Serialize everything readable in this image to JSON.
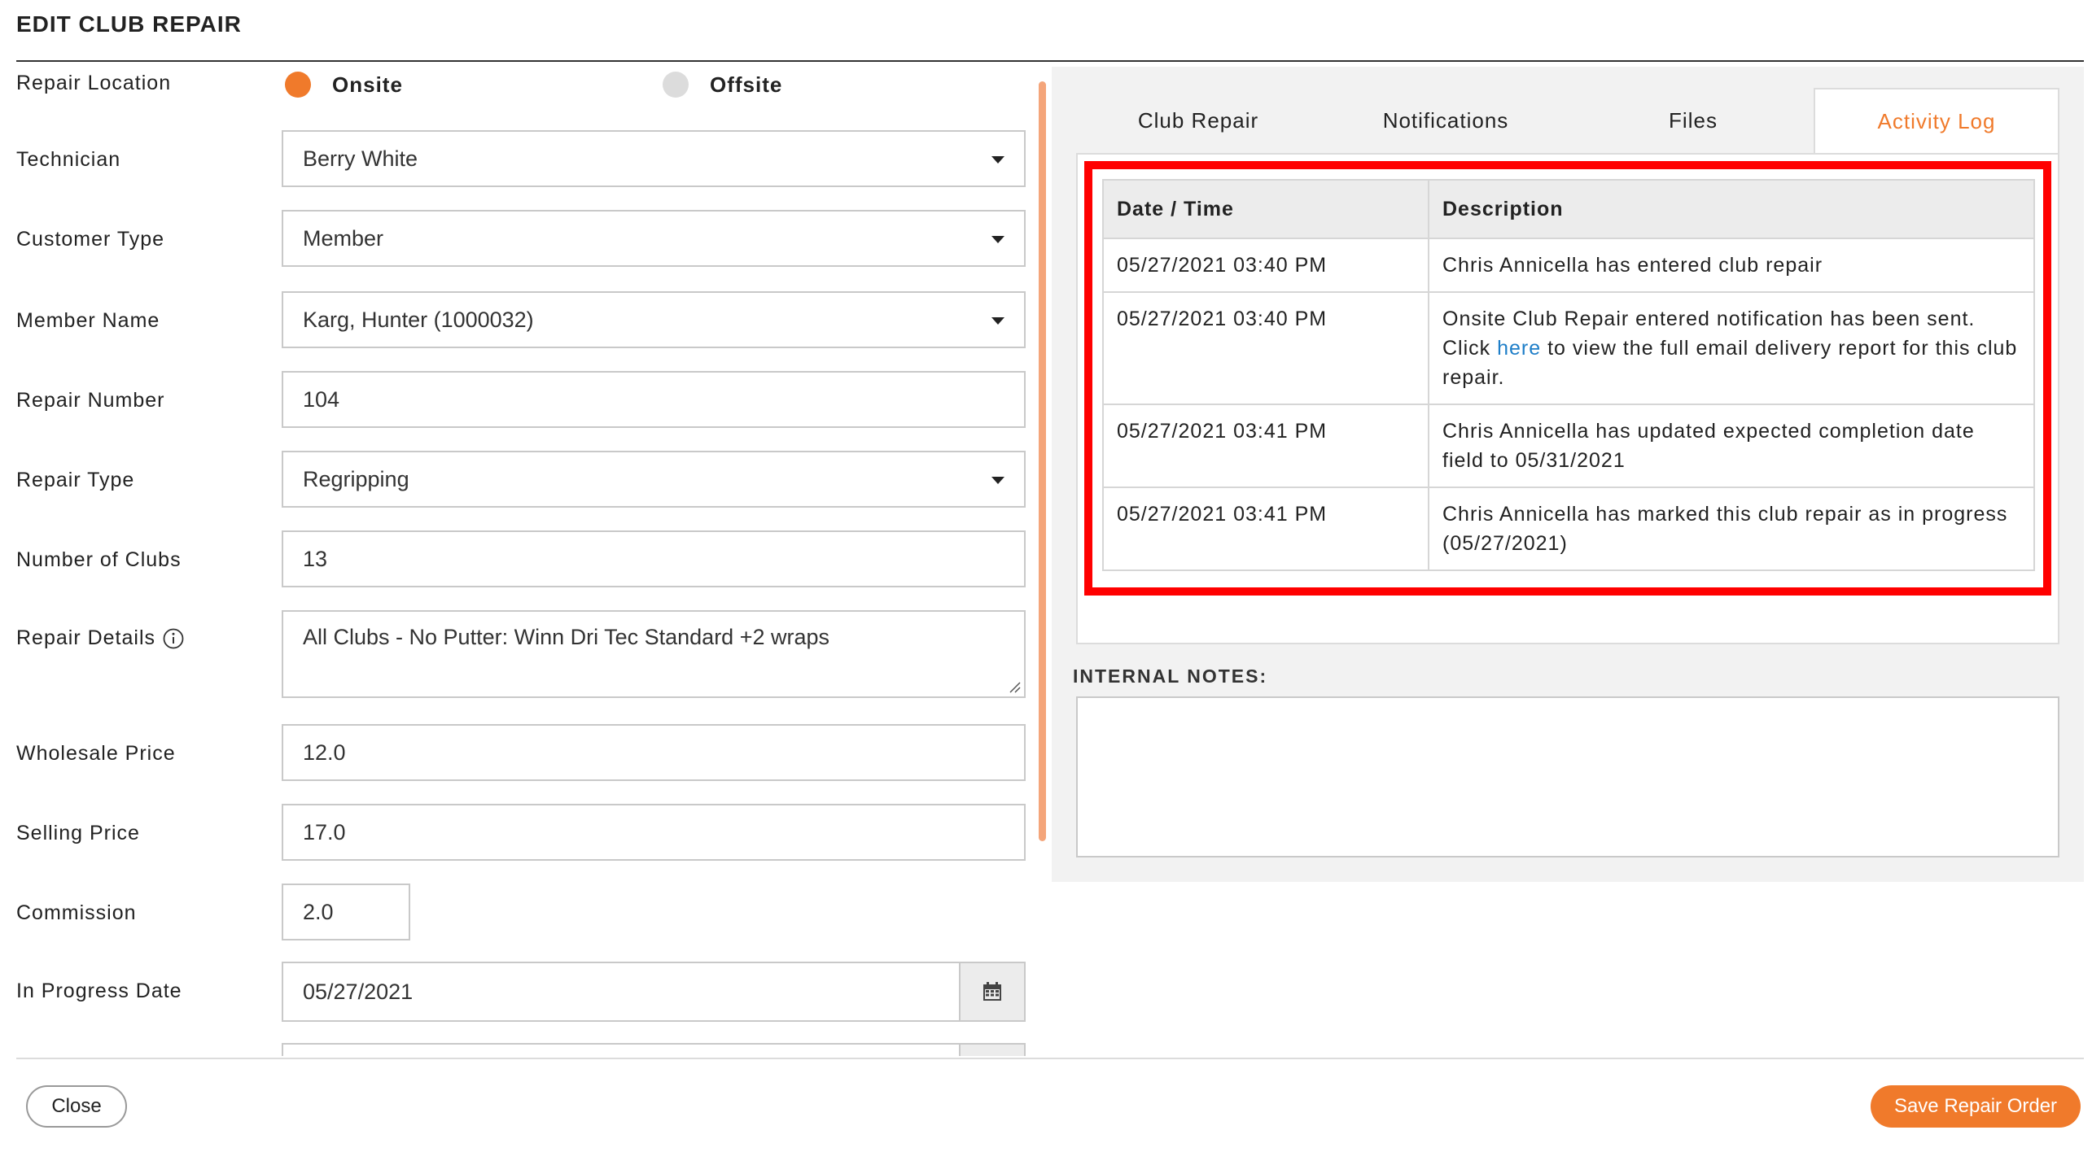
{
  "header": {
    "title": "EDIT CLUB REPAIR"
  },
  "form": {
    "repair_location": {
      "label": "Repair Location",
      "options": [
        "Onsite",
        "Offsite"
      ],
      "selected": "Onsite"
    },
    "technician": {
      "label": "Technician",
      "value": "Berry White"
    },
    "customer_type": {
      "label": "Customer Type",
      "value": "Member"
    },
    "member_name": {
      "label": "Member Name",
      "value": "Karg, Hunter (1000032)"
    },
    "repair_number": {
      "label": "Repair Number",
      "value": "104"
    },
    "repair_type": {
      "label": "Repair Type",
      "value": "Regripping"
    },
    "number_of_clubs": {
      "label": "Number of Clubs",
      "value": "13"
    },
    "repair_details": {
      "label": "Repair Details",
      "value": "All Clubs - No Putter: Winn Dri Tec Standard +2 wraps"
    },
    "wholesale_price": {
      "label": "Wholesale Price",
      "value": "12.0"
    },
    "selling_price": {
      "label": "Selling Price",
      "value": "17.0"
    },
    "commission": {
      "label": "Commission",
      "value": "2.0"
    },
    "in_progress_date": {
      "label": "In Progress Date",
      "value": "05/27/2021"
    }
  },
  "tabs": [
    "Club Repair",
    "Notifications",
    "Files",
    "Activity Log"
  ],
  "active_tab": "Activity Log",
  "activity_log": {
    "headers": [
      "Date / Time",
      "Description"
    ],
    "rows": [
      {
        "datetime": "05/27/2021 03:40 PM",
        "description": "Chris Annicella has entered club repair"
      },
      {
        "datetime": "05/27/2021 03:40 PM",
        "desc_pre": "Onsite Club Repair entered notification has been sent. Click ",
        "desc_link": "here",
        "desc_post": " to view the full email delivery report for this club repair."
      },
      {
        "datetime": "05/27/2021 03:41 PM",
        "description": "Chris Annicella has updated expected completion date field to 05/31/2021"
      },
      {
        "datetime": "05/27/2021 03:41 PM",
        "description": "Chris Annicella has marked this club repair as in progress (05/27/2021)"
      }
    ]
  },
  "internal_notes": {
    "label": "INTERNAL NOTES:",
    "value": ""
  },
  "footer": {
    "close_label": "Close",
    "save_label": "Save Repair Order"
  },
  "colors": {
    "accent": "#f07a2b",
    "highlight": "#ff0000",
    "link": "#1e7ec8"
  },
  "icons": {
    "calendar": "calendar-icon",
    "info": "info-icon",
    "caret": "chevron-down-icon"
  }
}
